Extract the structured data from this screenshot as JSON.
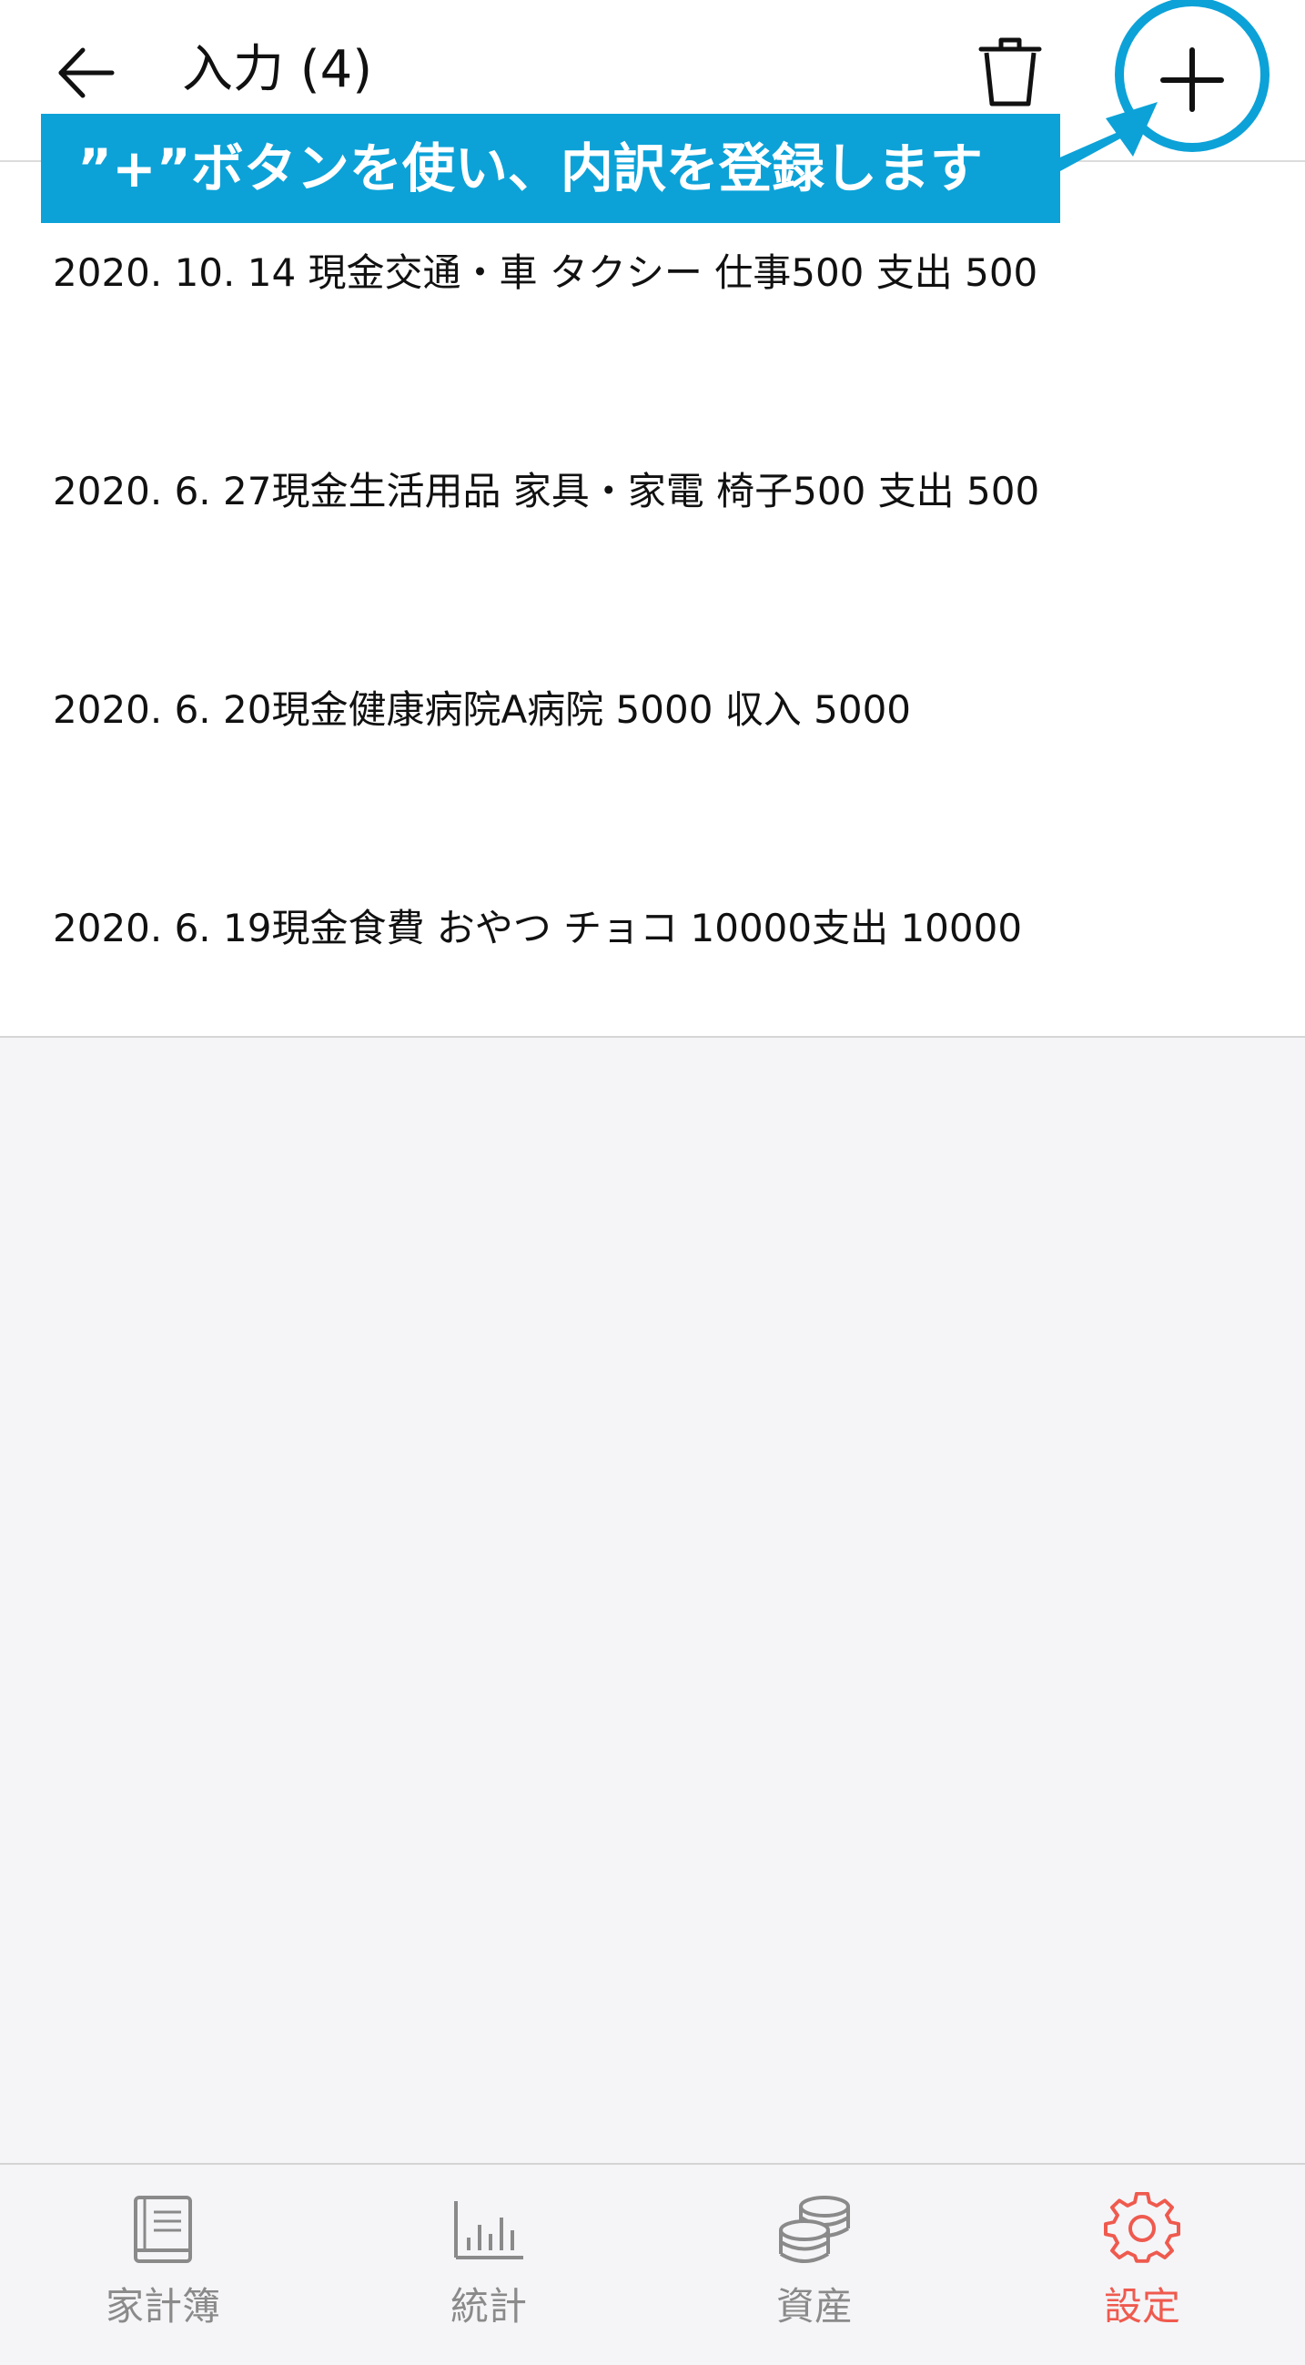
{
  "header": {
    "title": "入力 (4)",
    "back_icon": "arrow-left-icon",
    "trash_icon": "trash-icon",
    "add_icon": "plus-icon"
  },
  "annotation": {
    "text": "”+”ボタンを使い、内訳を登録します",
    "color": "#0ca2d8"
  },
  "entries": [
    "2020. 10. 14 現金交通・車 タクシー 仕事500  支出  500",
    "2020. 6. 27現金生活用品 家具・家電  椅子500  支出  500",
    "2020. 6. 20現金健康病院A病院 5000 収入  5000",
    "2020. 6. 19現金食費 おやつ チョコ 10000支出  10000"
  ],
  "tabs": [
    {
      "label": "家計簿",
      "icon": "book-icon",
      "active": false
    },
    {
      "label": "統計",
      "icon": "bar-chart-icon",
      "active": false
    },
    {
      "label": "資産",
      "icon": "coins-icon",
      "active": false
    },
    {
      "label": "設定",
      "icon": "gear-icon",
      "active": true
    }
  ],
  "colors": {
    "accent": "#ef5a4e",
    "inactive": "#8a8a8a",
    "background": "#f5f5f8"
  }
}
